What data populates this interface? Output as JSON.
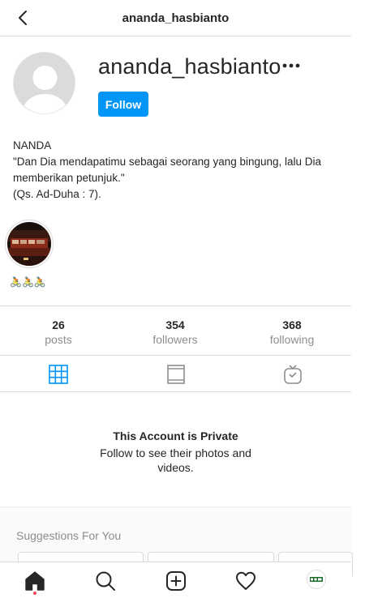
{
  "header": {
    "title": "ananda_hasbianto"
  },
  "profile": {
    "username": "ananda_hasbianto",
    "follow_label": "Follow",
    "bio_name": "NANDA",
    "bio_line1": "\"Dan Dia mendapatimu sebagai seorang yang bingung, lalu Dia memberikan petunjuk.\"",
    "bio_line2": "(Qs. Ad-Duha : 7).",
    "highlight_label": "🚴🚴🚴"
  },
  "stats": [
    {
      "value": "26",
      "label": "posts"
    },
    {
      "value": "354",
      "label": "followers"
    },
    {
      "value": "368",
      "label": "following"
    }
  ],
  "private": {
    "title": "This Account is Private",
    "subtitle": "Follow to see their photos and videos."
  },
  "suggestions": {
    "title": "Suggestions For You"
  },
  "icons": {
    "back": "chevron-left-icon",
    "more": "more-horizontal-icon",
    "tabs": [
      "grid-icon",
      "feed-icon",
      "igtv-icon"
    ],
    "nav": [
      "home-icon",
      "search-icon",
      "new-post-icon",
      "heart-icon",
      "profile-avatar"
    ]
  },
  "colors": {
    "accent": "#0095f6",
    "tab_active": "#0095f6",
    "muted": "#8e8e8e",
    "notification": "#ed4956"
  }
}
